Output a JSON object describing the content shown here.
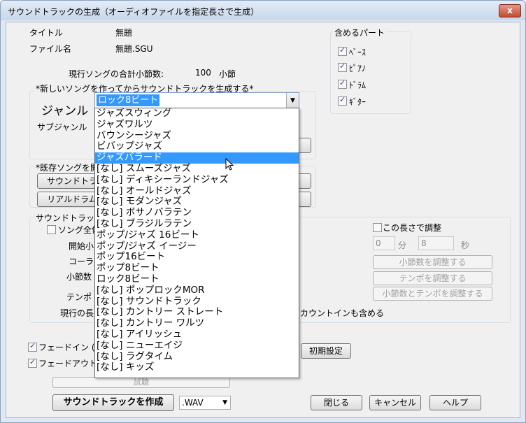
{
  "window": {
    "title": "サウンドトラックの生成（オーディオファイルを指定長さで生成）",
    "close_label": "x"
  },
  "info": {
    "title_label": "タイトル",
    "title_value": "無題",
    "file_label": "ファイル名",
    "file_value": "無題.SGU",
    "total_label": "現行ソングの合計小節数:",
    "total_value": "100",
    "total_unit": "小節"
  },
  "new_song": {
    "heading": "*新しいソングを作ってからサウンドトラックを生成する*",
    "genre_label": "ジャンル",
    "subgenre_label": "サブジャンル",
    "genre_selected": "ロック8ビート"
  },
  "existing": {
    "heading": "*既存ソングを開",
    "btn1": "サウンドトラッ",
    "btn2": "リアルドラムデ"
  },
  "soundtrack_group": {
    "heading": "サウンドトラック(",
    "whole_song": "ソング全体",
    "start_label": "開始小",
    "chorus_label": "コーラス",
    "bars_label": "小節数",
    "tempo_label": "テンポ",
    "current_len_label": "現行の長",
    "count_in": "カウントインも含める"
  },
  "adjust": {
    "length_check": "この長さで調整",
    "min_value": "0",
    "min_unit": "分",
    "sec_value": "8",
    "sec_unit": "秒",
    "btn_bars": "小節数を調整する",
    "btn_tempo": "テンポを調整する",
    "btn_both": "小節数とテンポを調整する"
  },
  "parts": {
    "heading": "含めるパート",
    "items": [
      {
        "label": "ﾍﾞｰｽ",
        "checked": true
      },
      {
        "label": "ﾋﾟｱﾉ",
        "checked": true
      },
      {
        "label": "ﾄﾞﾗﾑ",
        "checked": true
      },
      {
        "label": "ｷﾞﾀｰ",
        "checked": true
      }
    ]
  },
  "fade": {
    "fade_in": "フェードイン (秒",
    "fade_out": "フェードアウト (和",
    "reset": "初期設定"
  },
  "preview": {
    "label": "試聴"
  },
  "bottom": {
    "create": "サウンドトラックを作成",
    "format": ".WAV",
    "close": "閉じる",
    "cancel": "キャンセル",
    "help": "ヘルプ"
  },
  "genre_list": {
    "items": [
      "ジャズスウィング",
      "ジャズワルツ",
      "バウンシージャズ",
      "ビバップジャズ",
      "ジャズバラード",
      "[なし] スムーズジャズ",
      "[なし] ディキシーランドジャズ",
      "[なし] オールドジャズ",
      "[なし] モダンジャズ",
      "[なし] ボサノバラテン",
      "[なし] ブラジルラテン",
      "ポップ/ジャズ 16ビート",
      "ポップ/ジャズ イージー",
      "ポップ16ビート",
      "ポップ8ビート",
      "ロック8ビート",
      "[なし] ポップロックMOR",
      "[なし] サウンドトラック",
      "[なし] カントリー ストレート",
      "[なし] カントリー ワルツ",
      "[なし] アイリッシュ",
      "[なし] ニューエイジ",
      "[なし] ラグタイム",
      "[なし] キッズ"
    ],
    "highlighted_index": 4
  },
  "icons": {
    "dropdown_arrow": "chevron-down-icon",
    "pointer": "mouse-pointer-icon"
  },
  "colors": {
    "highlight": "#3399ff",
    "title_gradient_top": "#e4ecf7"
  }
}
